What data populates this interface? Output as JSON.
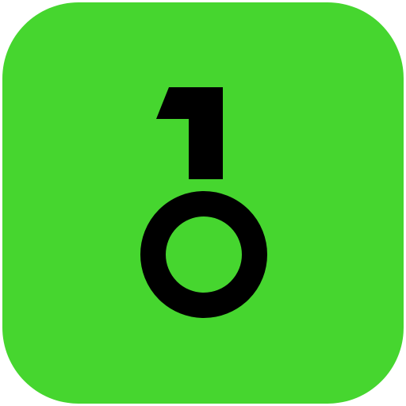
{
  "icon": {
    "name": "app-icon-10",
    "logo_text": "10",
    "colors": {
      "background": "#46D62F",
      "glyph": "#000000"
    }
  }
}
